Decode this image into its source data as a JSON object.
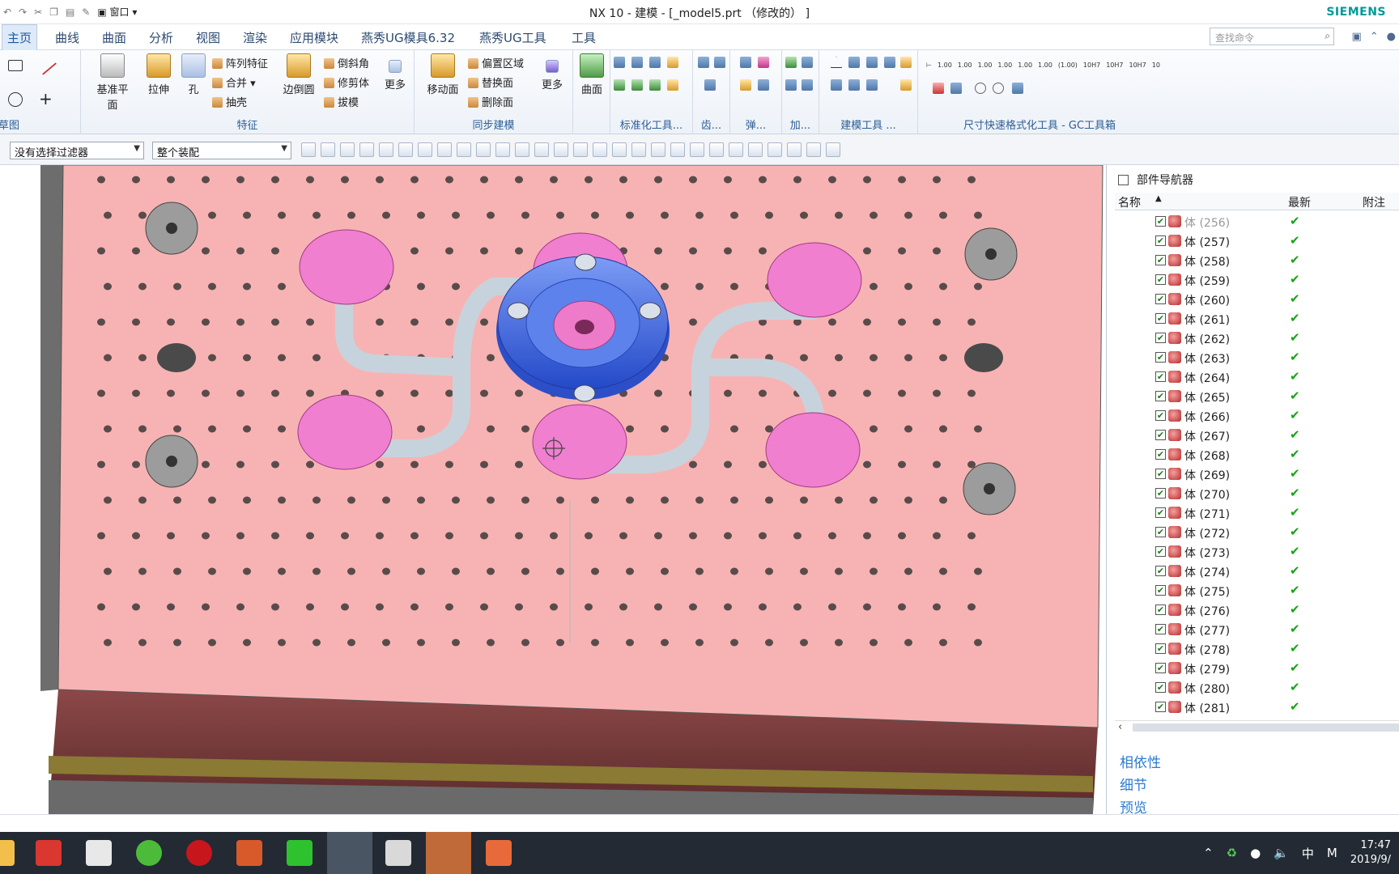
{
  "window": {
    "title": "NX 10 - 建模 - [_model5.prt （修改的） ]",
    "brand": "SIEMENS",
    "quick_access_window_menu": "窗口"
  },
  "menu_tabs": [
    "主页",
    "曲线",
    "曲面",
    "分析",
    "视图",
    "渲染",
    "应用模块",
    "燕秀UG模具6.32",
    "燕秀UG工具",
    "工具"
  ],
  "search": {
    "placeholder": "查找命令",
    "icon": "magnifier-icon"
  },
  "ribbon": {
    "sketch_group": {
      "label": "草图"
    },
    "feature_group": {
      "label": "特征",
      "datum_plane": "基准平面",
      "extrude": "拉伸",
      "hole": "孔",
      "pattern_feature": "阵列特征",
      "unite": "合并",
      "shell": "抽壳",
      "edge_blend": "边倒圆",
      "chamfer": "倒斜角",
      "trim_body": "修剪体",
      "draft": "拔模",
      "more": "更多"
    },
    "sync_group": {
      "label": "同步建模",
      "move_face": "移动面",
      "offset_region": "偏置区域",
      "replace_face": "替换面",
      "delete_face": "删除面",
      "more": "更多"
    },
    "surface_group": {
      "label": "曲面"
    },
    "standard_tools": {
      "label": "标准化工具..."
    },
    "gear": {
      "label": "齿..."
    },
    "spring": {
      "label": "弹..."
    },
    "addon": {
      "label": "加..."
    },
    "build_tools": {
      "label": "建模工具 ..."
    },
    "dim_tools": {
      "label": "尺寸快速格式化工具 - GC工具箱",
      "tol_labels": [
        "1.00",
        "1.00",
        "1.00",
        "1.00",
        "1.00",
        "1.00",
        "(1.00)",
        "10H7",
        "10H7",
        "10H7",
        "10"
      ]
    }
  },
  "selection_bar": {
    "filter": "没有选择过滤器",
    "scope": "整个装配"
  },
  "navigator": {
    "title": "部件导航器",
    "columns": [
      "名称",
      "最新",
      "附注"
    ],
    "rows": [
      {
        "name": "体 (256)",
        "latest": "✔",
        "dim": true
      },
      {
        "name": "体 (257)",
        "latest": "✔"
      },
      {
        "name": "体 (258)",
        "latest": "✔"
      },
      {
        "name": "体 (259)",
        "latest": "✔"
      },
      {
        "name": "体 (260)",
        "latest": "✔"
      },
      {
        "name": "体 (261)",
        "latest": "✔"
      },
      {
        "name": "体 (262)",
        "latest": "✔"
      },
      {
        "name": "体 (263)",
        "latest": "✔"
      },
      {
        "name": "体 (264)",
        "latest": "✔"
      },
      {
        "name": "体 (265)",
        "latest": "✔"
      },
      {
        "name": "体 (266)",
        "latest": "✔"
      },
      {
        "name": "体 (267)",
        "latest": "✔"
      },
      {
        "name": "体 (268)",
        "latest": "✔"
      },
      {
        "name": "体 (269)",
        "latest": "✔"
      },
      {
        "name": "体 (270)",
        "latest": "✔"
      },
      {
        "name": "体 (271)",
        "latest": "✔"
      },
      {
        "name": "体 (272)",
        "latest": "✔"
      },
      {
        "name": "体 (273)",
        "latest": "✔"
      },
      {
        "name": "体 (274)",
        "latest": "✔"
      },
      {
        "name": "体 (275)",
        "latest": "✔"
      },
      {
        "name": "体 (276)",
        "latest": "✔"
      },
      {
        "name": "体 (277)",
        "latest": "✔"
      },
      {
        "name": "体 (278)",
        "latest": "✔"
      },
      {
        "name": "体 (279)",
        "latest": "✔"
      },
      {
        "name": "体 (280)",
        "latest": "✔"
      },
      {
        "name": "体 (281)",
        "latest": "✔"
      }
    ],
    "sections": [
      "相依性",
      "细节",
      "预览"
    ]
  },
  "taskbar": {
    "tray": {
      "ime": "中",
      "m": "M",
      "time": "17:47",
      "date": "2019/9/"
    }
  },
  "colors": {
    "plate": "#f7b3b3",
    "boss": "#3e6fe0",
    "pads": "#f07fd0",
    "pipes": "#c7d3dc",
    "accent": "#1d5aa0"
  }
}
